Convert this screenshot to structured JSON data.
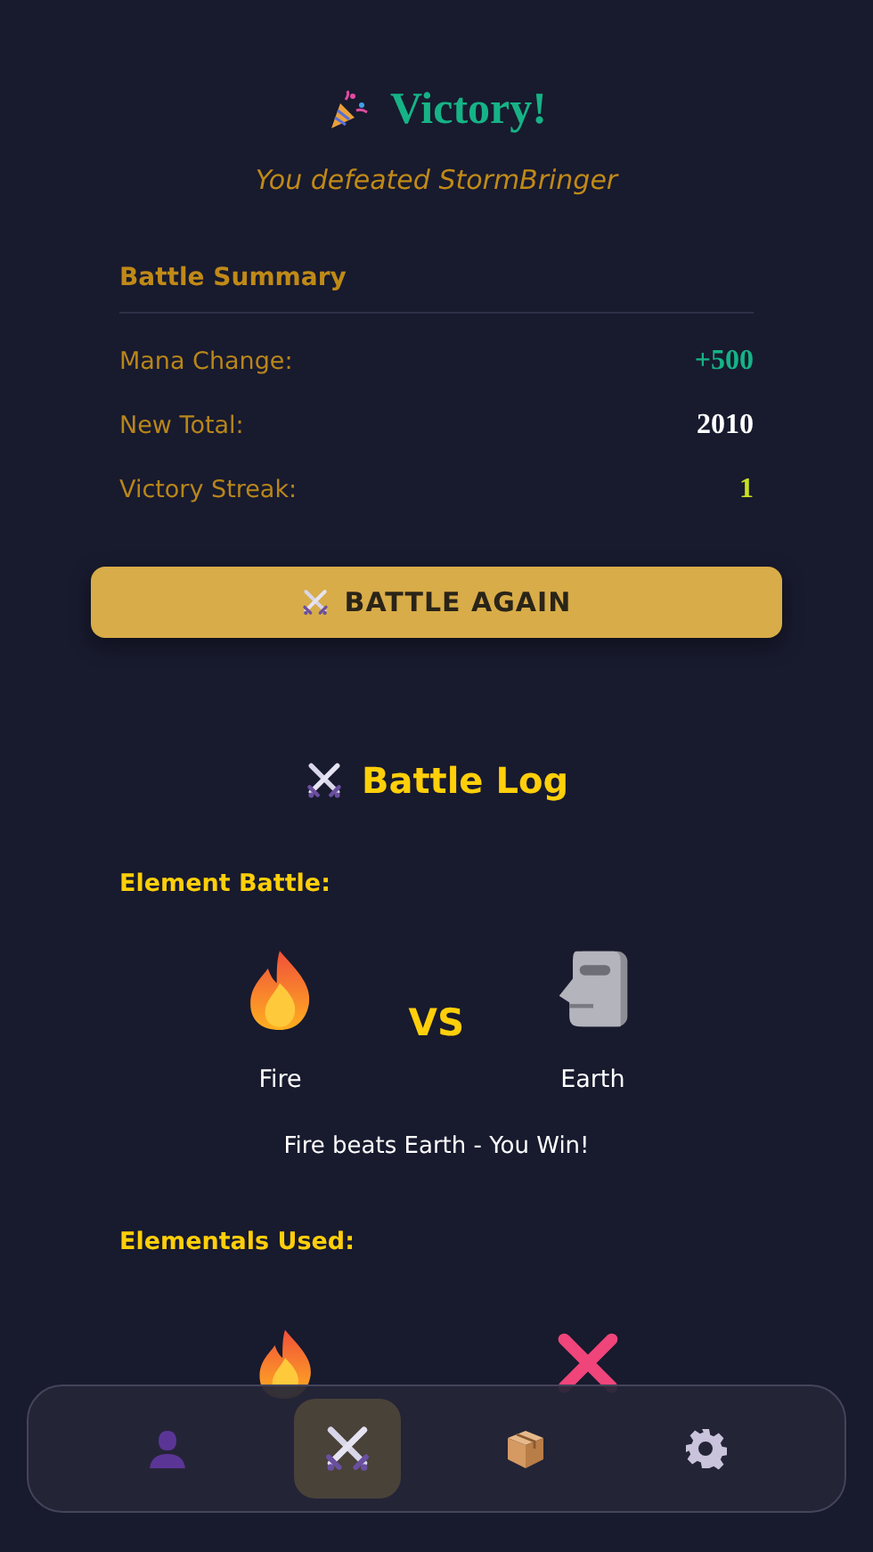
{
  "header": {
    "title": "Victory!",
    "subtitle": "You defeated StormBringer"
  },
  "summary": {
    "title": "Battle Summary",
    "rows": [
      {
        "label": "Mana Change:",
        "value": "+500",
        "kind": "gain"
      },
      {
        "label": "New Total:",
        "value": "2010",
        "kind": "total"
      },
      {
        "label": "Victory Streak:",
        "value": "1",
        "kind": "streak"
      }
    ]
  },
  "action_button": "BATTLE AGAIN",
  "battle_log": {
    "title": "Battle Log",
    "element_battle": {
      "heading": "Element Battle:",
      "player": {
        "name": "Fire",
        "kind": "fire"
      },
      "versus": "VS",
      "opponent": {
        "name": "Earth",
        "kind": "earth"
      },
      "result": "Fire beats Earth - You Win!"
    },
    "elementals_heading": "Elementals Used:",
    "elementals": [
      {
        "kind": "fire"
      },
      {
        "kind": "cross"
      }
    ]
  },
  "nav": [
    {
      "kind": "profile",
      "selected": false
    },
    {
      "kind": "battle",
      "selected": true
    },
    {
      "kind": "inventory",
      "selected": false
    },
    {
      "kind": "settings",
      "selected": false
    }
  ]
}
